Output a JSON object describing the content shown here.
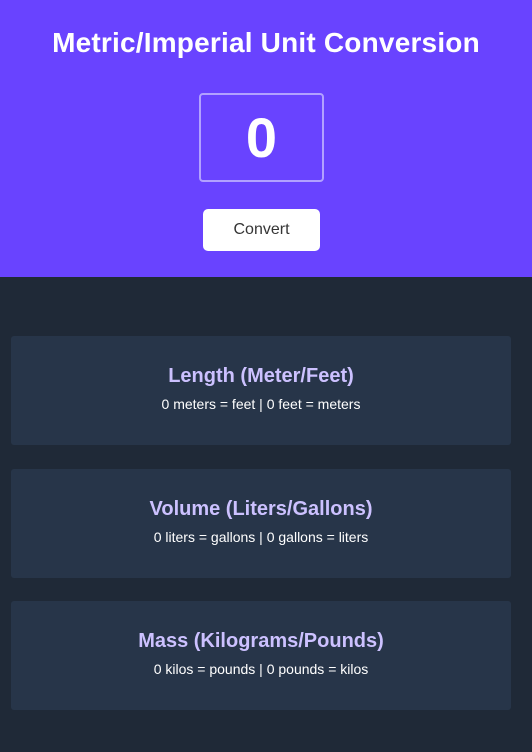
{
  "header": {
    "title": "Metric/Imperial Unit Conversion",
    "input_value": "0",
    "convert_label": "Convert"
  },
  "cards": [
    {
      "title": "Length (Meter/Feet)",
      "text": "0 meters = feet | 0 feet = meters"
    },
    {
      "title": "Volume (Liters/Gallons)",
      "text": "0 liters = gallons | 0 gallons = liters"
    },
    {
      "title": "Mass (Kilograms/Pounds)",
      "text": "0 kilos = pounds | 0 pounds = kilos"
    }
  ],
  "colors": {
    "header_bg": "#6943ff",
    "page_bg": "#1f2937",
    "card_bg": "#273549",
    "card_title": "#ccc1ff"
  }
}
